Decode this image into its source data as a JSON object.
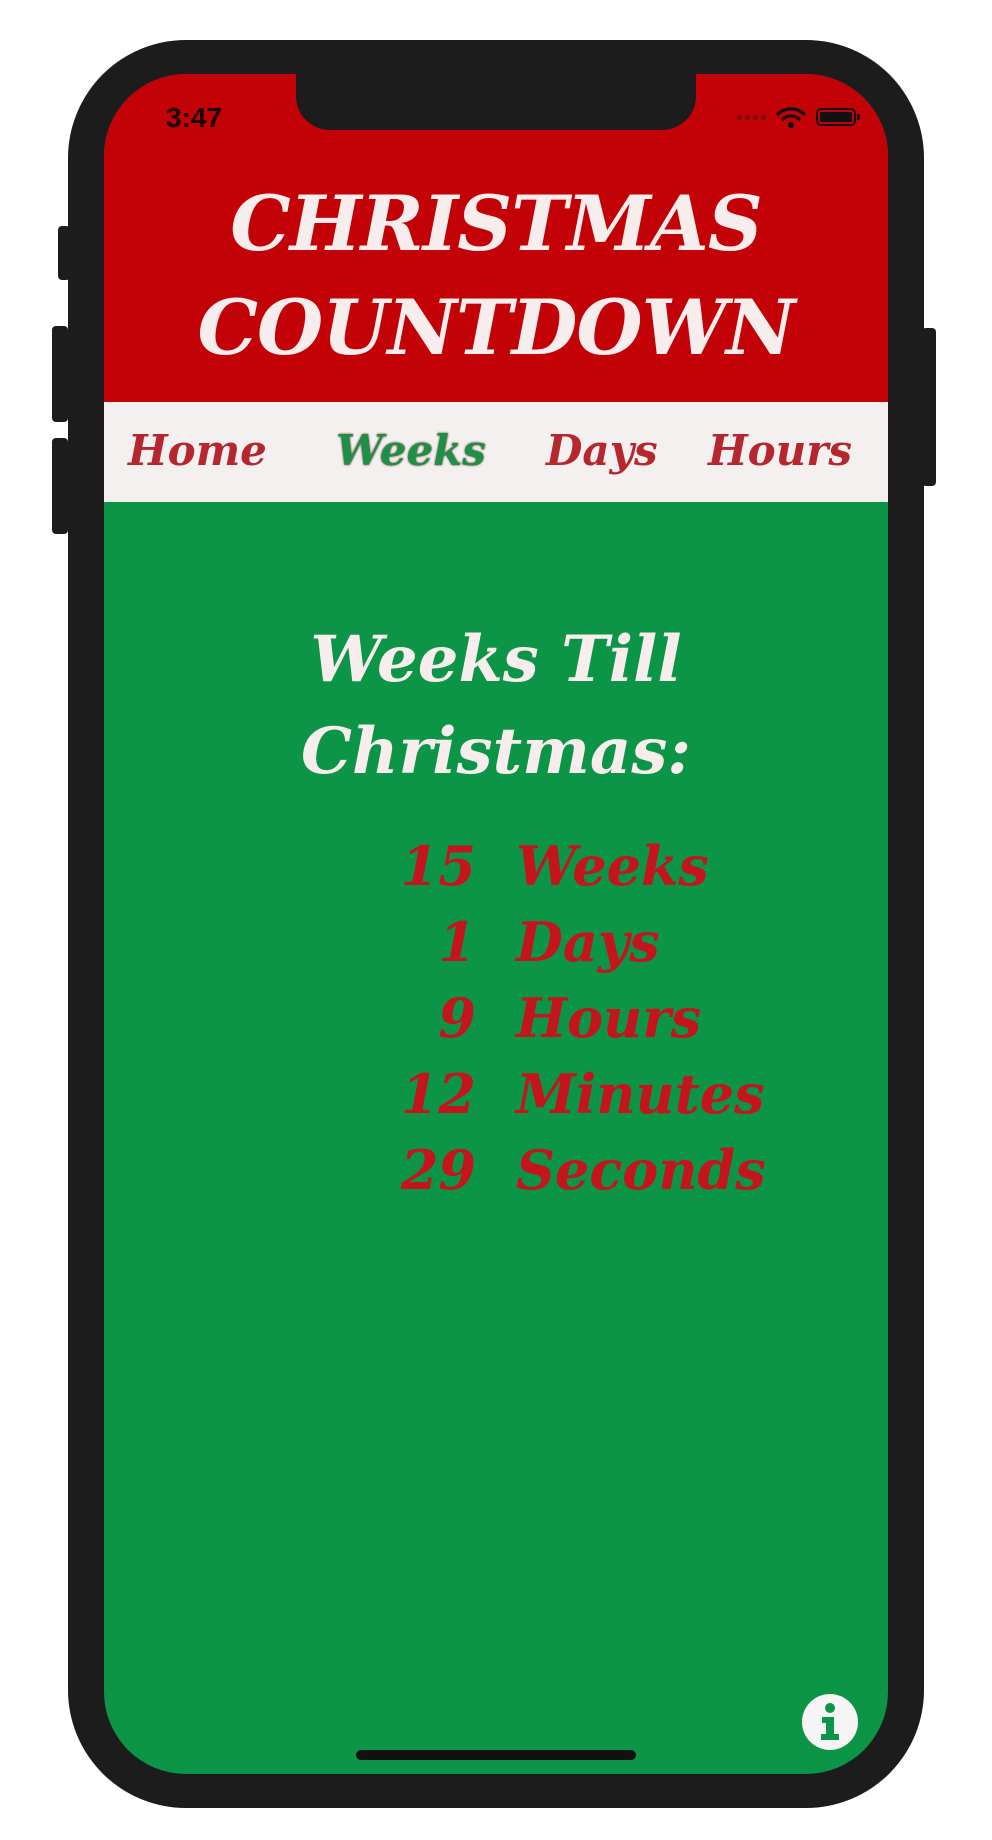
{
  "status_bar": {
    "time": "3:47"
  },
  "header": {
    "title_line1": "CHRISTMAS",
    "title_line2": "COUNTDOWN",
    "background_color": "#c20206"
  },
  "nav": {
    "active": "Weeks",
    "items": [
      {
        "label": "Home"
      },
      {
        "label": "Weeks"
      },
      {
        "label": "Days"
      },
      {
        "label": "Hours"
      }
    ]
  },
  "main": {
    "heading_line1": "Weeks Till",
    "heading_line2": "Christmas:",
    "background_color": "#0c9447",
    "countdown": [
      {
        "value": "15",
        "unit": "Weeks"
      },
      {
        "value": "1",
        "unit": "Days"
      },
      {
        "value": "9",
        "unit": "Hours"
      },
      {
        "value": "12",
        "unit": "Minutes"
      },
      {
        "value": "29",
        "unit": "Seconds"
      }
    ]
  },
  "icons": {
    "info": "info-icon",
    "wifi": "wifi-icon",
    "battery": "battery-icon",
    "cellular": "cellular-signal-icon"
  }
}
